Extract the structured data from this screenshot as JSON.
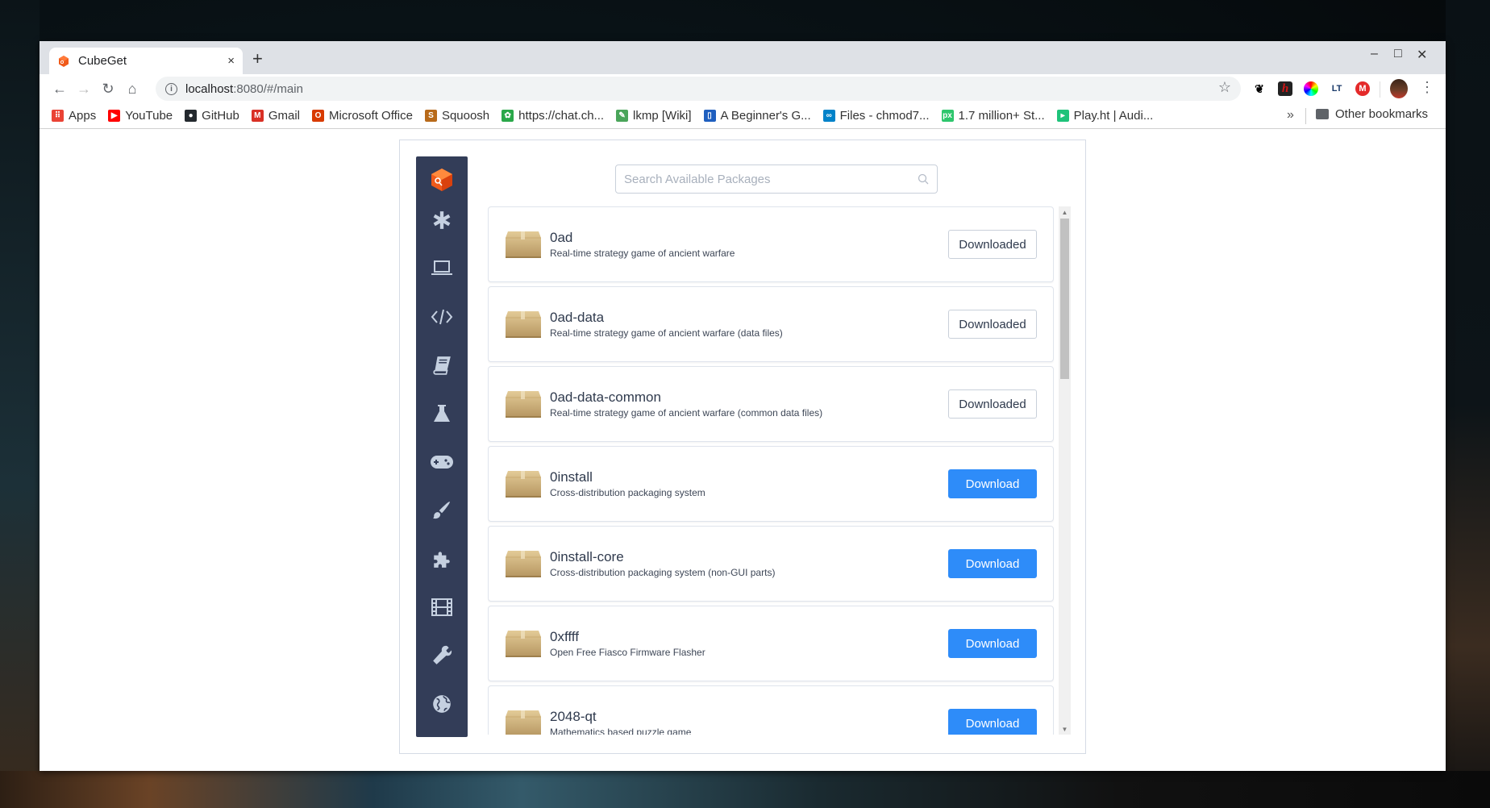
{
  "browser": {
    "tab": {
      "title": "CubeGet",
      "close": "×"
    },
    "new_tab": "+",
    "window_controls": {
      "minimize": "–",
      "maximize": "□",
      "close": "✕"
    },
    "nav": {
      "back": "←",
      "forward": "→",
      "reload": "↻",
      "home": "⌂"
    },
    "url": {
      "host": "localhost",
      "rest": ":8080/#/main"
    },
    "star": "☆",
    "extensions": [
      {
        "name": "gnome-extension",
        "label": "🐾",
        "color": "#ffffff",
        "fg": "#000000"
      },
      {
        "name": "hypothesis-extension",
        "label": "h",
        "color": "#222222",
        "fg": "#d01515"
      },
      {
        "name": "color-picker-extension",
        "label": "",
        "color": "conic",
        "fg": "#ffffff"
      },
      {
        "name": "languagetool-extension",
        "label": "LT",
        "color": "#ffffff",
        "fg": "#1a3a6a"
      },
      {
        "name": "mega-extension",
        "label": "M",
        "color": "#e42a2a",
        "fg": "#ffffff"
      }
    ],
    "menu": "⋮",
    "bookmarks": [
      {
        "label": "Apps",
        "icon": "apps-grid-icon",
        "color": "#ea4335",
        "glyph": "⠿"
      },
      {
        "label": "YouTube",
        "icon": "youtube-icon",
        "color": "#ff0000",
        "glyph": "▶"
      },
      {
        "label": "GitHub",
        "icon": "github-icon",
        "color": "#24292e",
        "glyph": "●"
      },
      {
        "label": "Gmail",
        "icon": "gmail-icon",
        "color": "#d93025",
        "glyph": "M"
      },
      {
        "label": "Microsoft Office",
        "icon": "office-icon",
        "color": "#d83b01",
        "glyph": "O"
      },
      {
        "label": "Squoosh",
        "icon": "squoosh-icon",
        "color": "#b86a1a",
        "glyph": "S"
      },
      {
        "label": "https://chat.ch...",
        "icon": "chat-icon",
        "color": "#2aa84a",
        "glyph": "✿"
      },
      {
        "label": "lkmp [Wiki]",
        "icon": "wiki-icon",
        "color": "#4aa55a",
        "glyph": "✎"
      },
      {
        "label": "A Beginner's G...",
        "icon": "doc-icon",
        "color": "#1f5fbf",
        "glyph": "▯"
      },
      {
        "label": "Files - chmod7...",
        "icon": "nextcloud-icon",
        "color": "#0082c9",
        "glyph": "∞"
      },
      {
        "label": "1.7 million+ St...",
        "icon": "pixabay-icon",
        "color": "#2ec66d",
        "glyph": "px"
      },
      {
        "label": "Play.ht | Audi...",
        "icon": "playht-icon",
        "color": "#1ec37a",
        "glyph": "▸"
      }
    ],
    "bookmarks_more": "»",
    "other_bookmarks": "Other bookmarks"
  },
  "app": {
    "search": {
      "placeholder": "Search Available Packages",
      "value": ""
    },
    "sidebar": [
      {
        "name": "logo"
      },
      {
        "name": "all-packages",
        "icon": "asterisk-icon"
      },
      {
        "name": "system",
        "icon": "laptop-icon"
      },
      {
        "name": "development",
        "icon": "code-icon"
      },
      {
        "name": "education",
        "icon": "book-icon"
      },
      {
        "name": "science",
        "icon": "flask-icon"
      },
      {
        "name": "games",
        "icon": "gamepad-icon"
      },
      {
        "name": "graphics",
        "icon": "paintbrush-icon"
      },
      {
        "name": "addons",
        "icon": "puzzle-icon"
      },
      {
        "name": "multimedia",
        "icon": "film-icon"
      },
      {
        "name": "utilities",
        "icon": "wrench-icon"
      },
      {
        "name": "internet",
        "icon": "globe-icon"
      }
    ],
    "packages": [
      {
        "name": "0ad",
        "description": "Real-time strategy game of ancient warfare",
        "status": "downloaded",
        "button": "Downloaded"
      },
      {
        "name": "0ad-data",
        "description": "Real-time strategy game of ancient warfare (data files)",
        "status": "downloaded",
        "button": "Downloaded"
      },
      {
        "name": "0ad-data-common",
        "description": "Real-time strategy game of ancient warfare (common data files)",
        "status": "downloaded",
        "button": "Downloaded"
      },
      {
        "name": "0install",
        "description": "Cross-distribution packaging system",
        "status": "download",
        "button": "Download"
      },
      {
        "name": "0install-core",
        "description": "Cross-distribution packaging system (non-GUI parts)",
        "status": "download",
        "button": "Download"
      },
      {
        "name": "0xffff",
        "description": "Open Free Fiasco Firmware Flasher",
        "status": "download",
        "button": "Download"
      },
      {
        "name": "2048-qt",
        "description": "Mathematics based puzzle game",
        "status": "download",
        "button": "Download"
      }
    ],
    "colors": {
      "sidebar": "#333d58",
      "accent": "#2e8cf9",
      "logo": "#f05a1a"
    }
  }
}
